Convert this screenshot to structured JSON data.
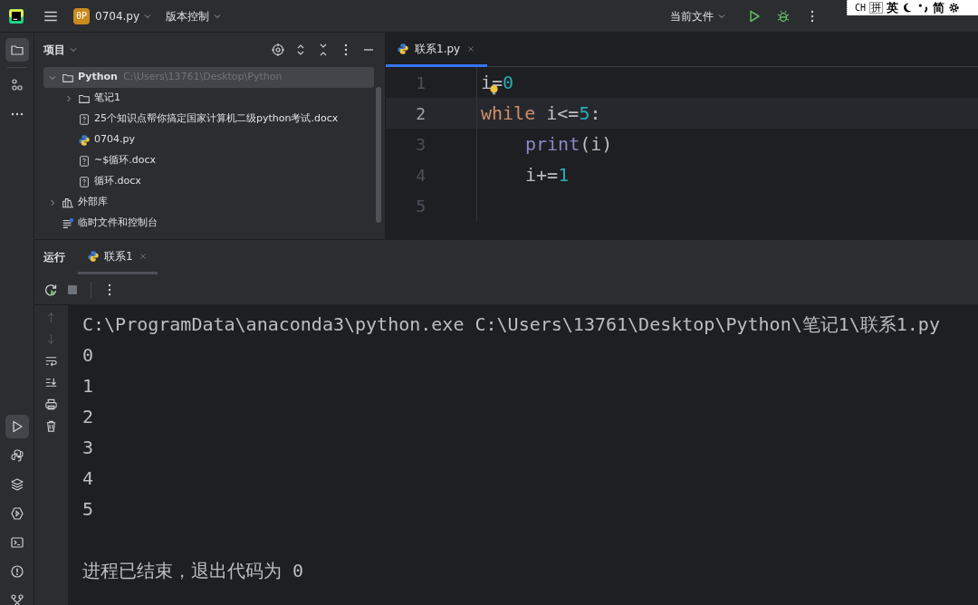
{
  "toolbar": {
    "project_badge": "0P",
    "project": "0704.py",
    "vcs": "版本控制",
    "run_config": "当前文件"
  },
  "ime_bar": [
    {
      "kind": "text",
      "label": "CH"
    },
    {
      "kind": "boxed",
      "label": "拼"
    },
    {
      "kind": "text",
      "label": "英"
    },
    {
      "kind": "moon"
    },
    {
      "kind": "punct"
    },
    {
      "kind": "text",
      "label": "简"
    },
    {
      "kind": "gear"
    }
  ],
  "left_strip": {
    "top": [
      {
        "kind": "folder",
        "selected": true
      },
      {
        "kind": "structure",
        "selected": false
      },
      {
        "kind": "more",
        "selected": false
      }
    ],
    "bottom": [
      {
        "kind": "run",
        "selected": true
      },
      {
        "kind": "python",
        "selected": false
      },
      {
        "kind": "layers",
        "selected": false
      },
      {
        "kind": "services",
        "selected": false
      },
      {
        "kind": "terminal",
        "selected": false
      },
      {
        "kind": "problems",
        "selected": false
      },
      {
        "kind": "git",
        "selected": false
      }
    ]
  },
  "project_panel": {
    "title": "项目",
    "tree": [
      {
        "kind": "folder",
        "label": "Python",
        "path": "C:\\Users\\13761\\Desktop\\Python",
        "expanded": true,
        "selected": true,
        "children": [
          {
            "kind": "folder",
            "label": "笔记1",
            "expanded": false,
            "selected": false
          },
          {
            "kind": "unknown",
            "label": "25个知识点帮你搞定国家计算机二级python考试.docx",
            "selected": false
          },
          {
            "kind": "python",
            "label": "0704.py",
            "selected": false
          },
          {
            "kind": "unknown",
            "label": "~$循环.docx",
            "selected": false
          },
          {
            "kind": "unknown",
            "label": "循环.docx",
            "selected": false
          }
        ]
      },
      {
        "kind": "library",
        "label": "外部库",
        "expanded": false,
        "selected": false
      },
      {
        "kind": "scratch",
        "label": "临时文件和控制台",
        "selected": false
      }
    ]
  },
  "editor": {
    "tabs": [
      {
        "label": "联系1.py",
        "selected": true
      }
    ],
    "lines": [
      {
        "number": "1",
        "current": false,
        "indented": false,
        "tokens": [
          {
            "kind": "plain",
            "text": "i="
          },
          {
            "kind": "number",
            "text": "0"
          }
        ]
      },
      {
        "number": "2",
        "current": true,
        "indented": false,
        "tokens": [
          {
            "kind": "keyword",
            "text": "while"
          },
          {
            "kind": "plain",
            "text": " i<="
          },
          {
            "kind": "number",
            "text": "5"
          },
          {
            "kind": "plain",
            "text": ":"
          }
        ]
      },
      {
        "number": "3",
        "current": false,
        "indented": true,
        "tokens": [
          {
            "kind": "builtin",
            "text": "print"
          },
          {
            "kind": "plain",
            "text": "(i)"
          }
        ]
      },
      {
        "number": "4",
        "current": false,
        "indented": true,
        "tokens": [
          {
            "kind": "plain",
            "text": "i+="
          },
          {
            "kind": "number",
            "text": "1"
          }
        ]
      },
      {
        "number": "5",
        "current": false
      }
    ]
  },
  "run_panel": {
    "title": "运行",
    "tabs": [
      {
        "label": "联系1",
        "selected": true
      }
    ],
    "output": [
      "C:\\ProgramData\\anaconda3\\python.exe C:\\Users\\13761\\Desktop\\Python\\笔记1\\联系1.py",
      "0",
      "1",
      "2",
      "3",
      "4",
      "5"
    ],
    "exit_message": "进程已结束，退出代码为 0"
  }
}
